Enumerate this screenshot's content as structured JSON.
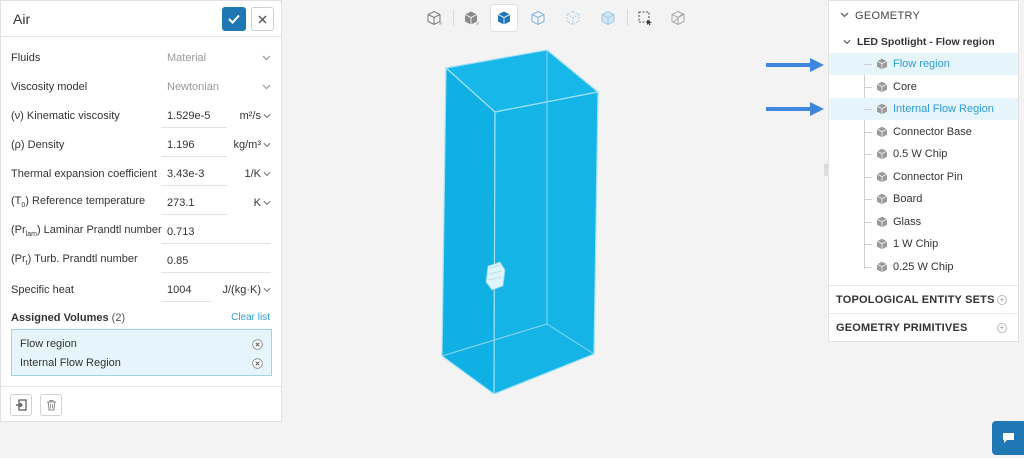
{
  "left_panel": {
    "title": "Air",
    "properties": [
      {
        "label": "Fluids",
        "value": "Material",
        "unit": "",
        "dropdown": true
      },
      {
        "label": "Viscosity model",
        "value": "Newtonian",
        "unit": "",
        "dropdown": true
      },
      {
        "label": "(ν) Kinematic viscosity",
        "value": "1.529e-5",
        "unit": "m²/s"
      },
      {
        "label": "(ρ) Density",
        "value": "1.196",
        "unit": "kg/m³"
      },
      {
        "label": "Thermal expansion coefficient",
        "value": "3.43e-3",
        "unit": "1/K"
      },
      {
        "label_pre": "(T",
        "label_sub": "0",
        "label_post": ") Reference temperature",
        "value": "273.1",
        "unit": "K"
      },
      {
        "label_pre": "(Pr",
        "label_sub": "lam",
        "label_post": ") Laminar Prandtl number",
        "value": "0.713",
        "unit": ""
      },
      {
        "label_pre": "(Pr",
        "label_sub": "t",
        "label_post": ") Turb. Prandtl number",
        "value": "0.85",
        "unit": ""
      },
      {
        "label": "Specific heat",
        "value": "1004",
        "unit": "J/(kg·K)"
      }
    ],
    "assigned": {
      "title": "Assigned Volumes",
      "count": "(2)",
      "clear_label": "Clear list",
      "items": [
        "Flow region",
        "Internal Flow Region"
      ]
    }
  },
  "tree": {
    "header": "GEOMETRY",
    "root": "LED Spotlight - Flow region",
    "items": [
      {
        "label": "Flow region",
        "selected": true
      },
      {
        "label": "Core",
        "selected": false
      },
      {
        "label": "Internal Flow Region",
        "selected": true
      },
      {
        "label": "Connector Base",
        "selected": false
      },
      {
        "label": "0.5 W Chip",
        "selected": false
      },
      {
        "label": "Connector Pin",
        "selected": false
      },
      {
        "label": "Board",
        "selected": false
      },
      {
        "label": "Glass",
        "selected": false
      },
      {
        "label": "1 W Chip",
        "selected": false
      },
      {
        "label": "0.25 W Chip",
        "selected": false
      }
    ],
    "sections": [
      "TOPOLOGICAL ENTITY SETS",
      "GEOMETRY PRIMITIVES"
    ]
  },
  "toolbar": {
    "buttons": [
      "solid-view-icon",
      "surface-view-icon",
      "selected-cube-icon",
      "wireframe-cube-icon",
      "points-cube-icon",
      "transparent-cube-icon",
      "box-select-icon",
      "hide-cube-icon"
    ]
  },
  "colors": {
    "accent": "#1f78b4",
    "link": "#2e9bd6",
    "volume": "#12b3e6",
    "arrow": "#3f87dc",
    "selection_bg": "#e6f5fb"
  }
}
